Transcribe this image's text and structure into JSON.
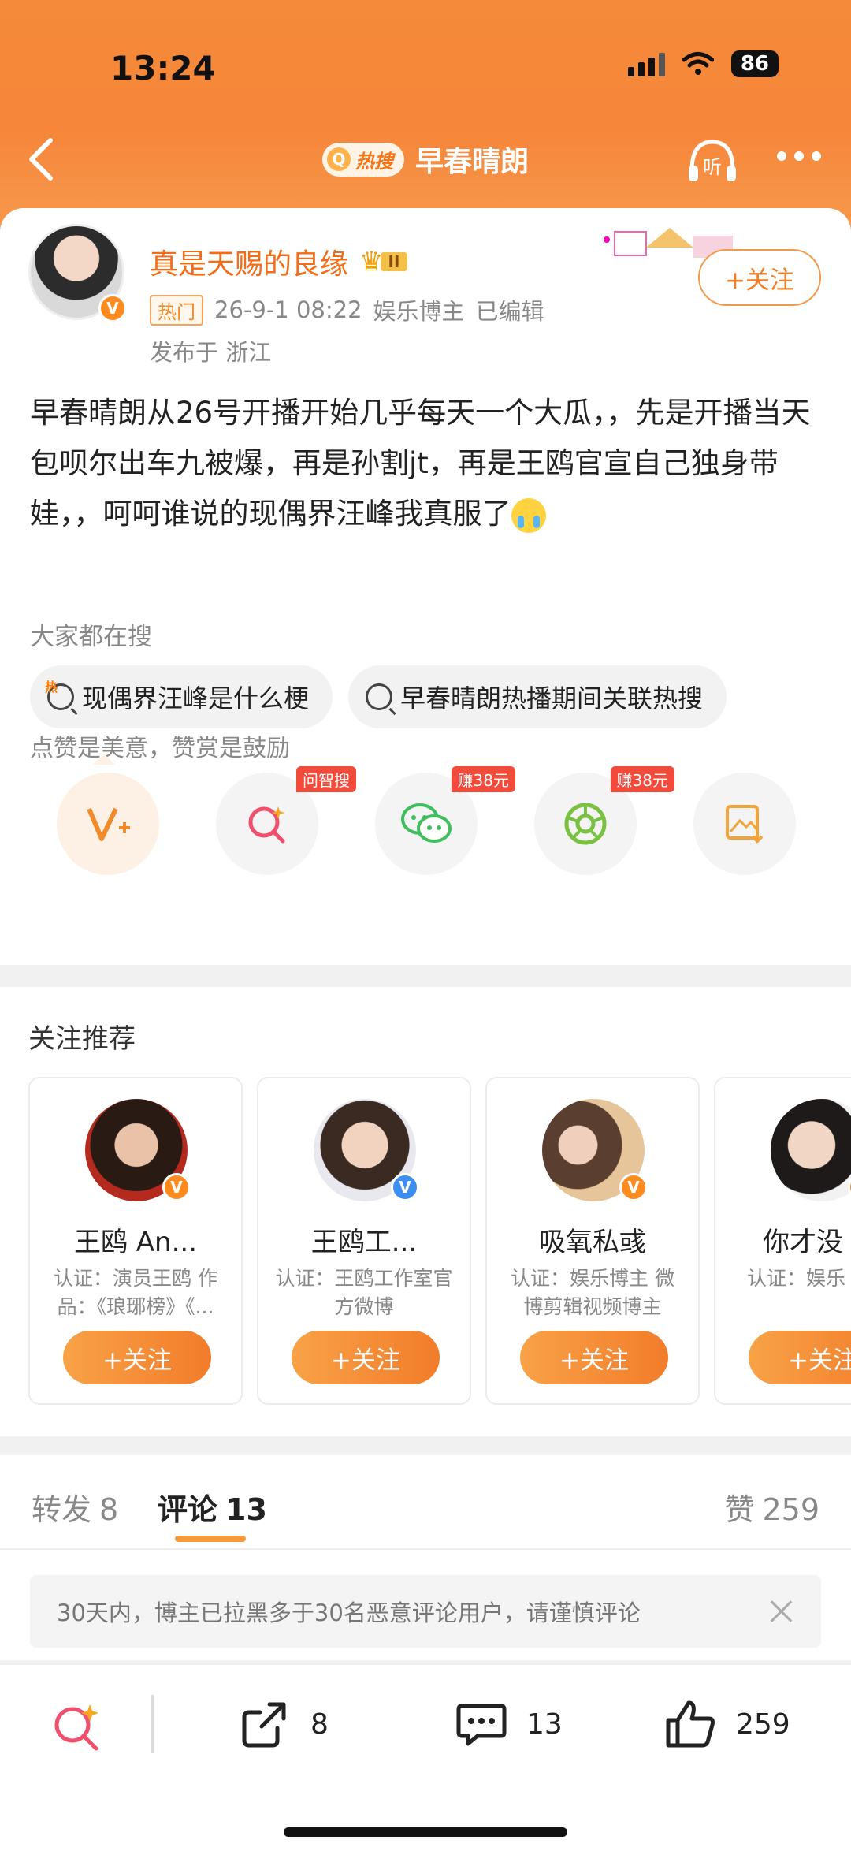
{
  "status_bar": {
    "time": "13:24",
    "battery": "86"
  },
  "nav": {
    "hot_label": "热搜",
    "title": "早春晴朗",
    "listen_label": "听"
  },
  "post": {
    "author_name": "真是天赐的良缘",
    "level": "II",
    "hot_tag": "热门",
    "date": "26-9-1 08:22",
    "source": "娱乐博主",
    "edited": "已编辑",
    "location": "发布于 浙江",
    "follow_label": "+关注",
    "text": "早春晴朗从26号开播开始几乎每天一个大瓜，，先是开播当天包呗尔出车九被爆，再是孙割jt，再是王鸥官宣自己独身带娃，，呵呵谁说的现偶界汪峰我真服了",
    "search_title": "大家都在搜",
    "searches": [
      "现偶界汪峰是什么梗",
      "早春晴朗热播期间关联热搜"
    ],
    "reward_text": "点赞是美意，赞赏是鼓励",
    "action_tags": {
      "ask": "问智搜",
      "wechat": "赚38元",
      "moments": "赚38元"
    }
  },
  "recommendations": {
    "title": "关注推荐",
    "items": [
      {
        "name": "王鸥 An...",
        "desc": "认证：演员王鸥 作品：《琅琊榜》《...",
        "follow": "+关注"
      },
      {
        "name": "王鸥工...",
        "desc": "认证：王鸥工作室官方微博",
        "follow": "+关注"
      },
      {
        "name": "吸氧私彧",
        "desc": "认证：娱乐博主 微博剪辑视频博主",
        "follow": "+关注"
      },
      {
        "name": "你才没",
        "desc": "认证：娱乐",
        "follow": "+关注"
      }
    ]
  },
  "tabs": {
    "repost_label": "转发",
    "repost_count": "8",
    "comment_label": "评论",
    "comment_count": "13",
    "like_label": "赞",
    "like_count": "259"
  },
  "notice": "30天内，博主已拉黑多于30名恶意评论用户，请谨慎评论",
  "bottom_bar": {
    "repost": "8",
    "comment": "13",
    "like": "259"
  },
  "colors": {
    "brand_orange": "#f6863a",
    "accent": "#f37d24"
  }
}
